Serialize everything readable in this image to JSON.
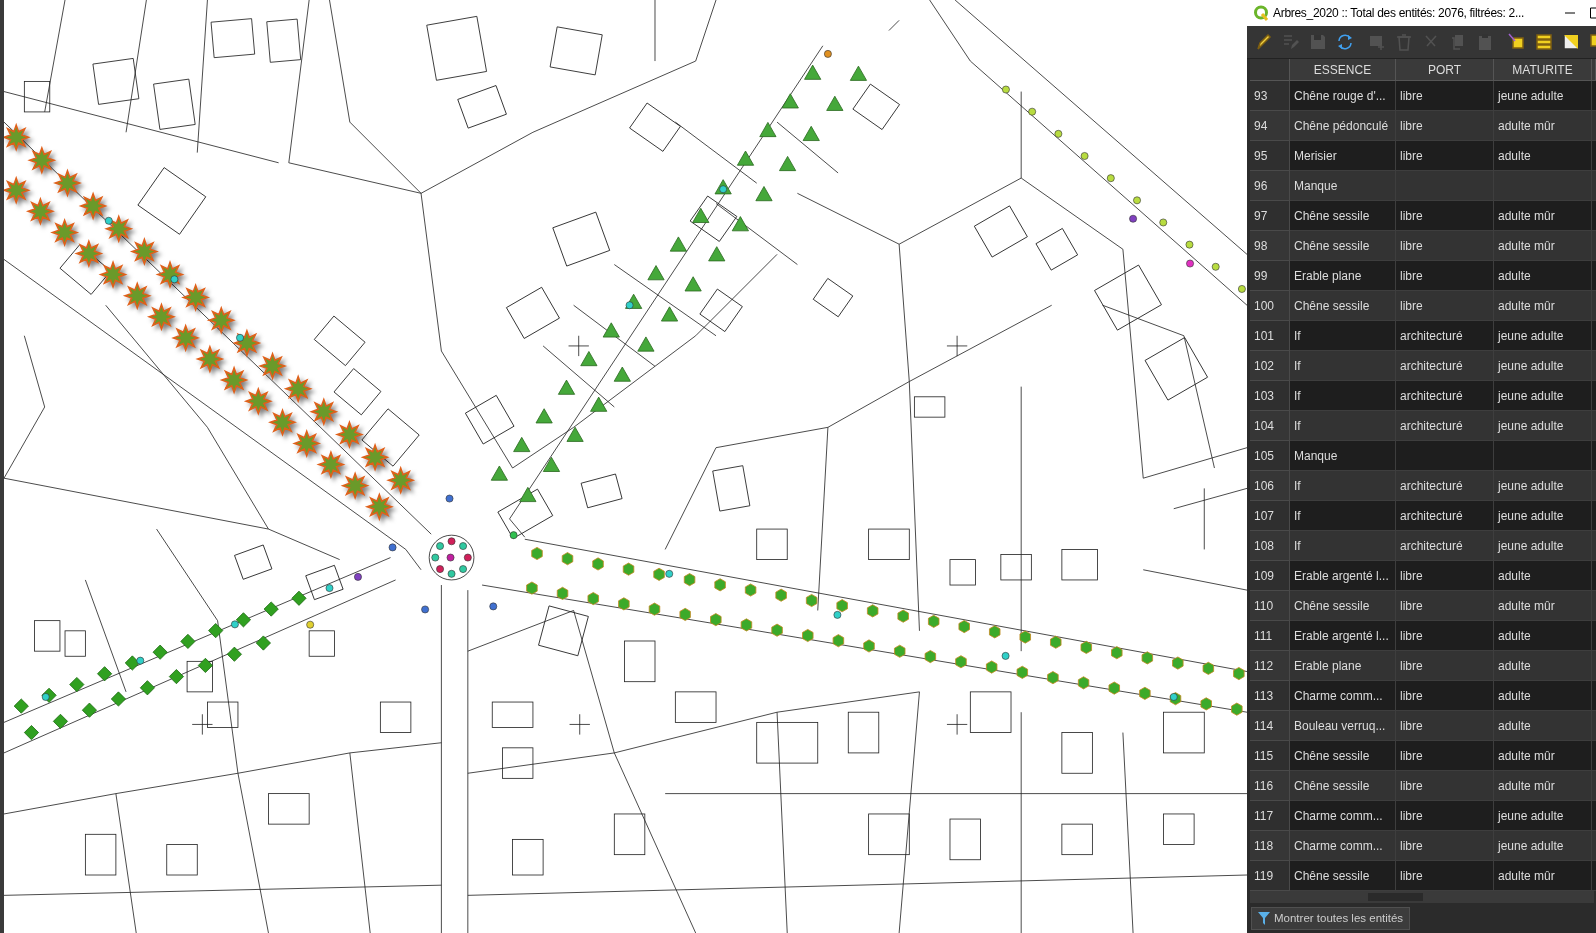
{
  "window": {
    "title": "Arbres_2020 :: Total des entités: 2076, filtrées: 2..."
  },
  "toolbar": [
    {
      "kind": "pencil",
      "disabled": false
    },
    {
      "kind": "multi-edit",
      "disabled": true
    },
    {
      "kind": "save",
      "disabled": true
    },
    {
      "kind": "reload",
      "disabled": false
    },
    {
      "kind": "add",
      "disabled": true
    },
    {
      "kind": "delete",
      "disabled": true
    },
    {
      "kind": "cut",
      "disabled": true
    },
    {
      "kind": "copy",
      "disabled": true
    },
    {
      "kind": "paste",
      "disabled": true
    },
    {
      "kind": "select-expression",
      "disabled": false
    },
    {
      "kind": "select-all",
      "disabled": false
    },
    {
      "kind": "invert",
      "disabled": false
    },
    {
      "kind": "deselect",
      "disabled": false
    }
  ],
  "table": {
    "columns": [
      "ESSENCE",
      "PORT",
      "MATURITE"
    ],
    "rows": [
      {
        "id": "93",
        "essence": "Chêne rouge d'...",
        "port": "libre",
        "maturite": "jeune adulte"
      },
      {
        "id": "94",
        "essence": "Chêne pédonculé",
        "port": "libre",
        "maturite": "adulte mûr"
      },
      {
        "id": "95",
        "essence": "Merisier",
        "port": "libre",
        "maturite": "adulte"
      },
      {
        "id": "96",
        "essence": "Manque"
      },
      {
        "id": "97",
        "essence": "Chêne sessile",
        "port": "libre",
        "maturite": "adulte mûr"
      },
      {
        "id": "98",
        "essence": "Chêne sessile",
        "port": "libre",
        "maturite": "adulte mûr"
      },
      {
        "id": "99",
        "essence": "Erable plane",
        "port": "libre",
        "maturite": "adulte"
      },
      {
        "id": "100",
        "essence": "Chêne sessile",
        "port": "libre",
        "maturite": "adulte mûr"
      },
      {
        "id": "101",
        "essence": "If",
        "port": "architecturé",
        "maturite": "jeune adulte"
      },
      {
        "id": "102",
        "essence": "If",
        "port": "architecturé",
        "maturite": "jeune adulte"
      },
      {
        "id": "103",
        "essence": "If",
        "port": "architecturé",
        "maturite": "jeune adulte"
      },
      {
        "id": "104",
        "essence": "If",
        "port": "architecturé",
        "maturite": "jeune adulte"
      },
      {
        "id": "105",
        "essence": "Manque"
      },
      {
        "id": "106",
        "essence": "If",
        "port": "architecturé",
        "maturite": "jeune adulte"
      },
      {
        "id": "107",
        "essence": "If",
        "port": "architecturé",
        "maturite": "jeune adulte"
      },
      {
        "id": "108",
        "essence": "If",
        "port": "architecturé",
        "maturite": "jeune adulte"
      },
      {
        "id": "109",
        "essence": "Erable argenté l...",
        "port": "libre",
        "maturite": "adulte"
      },
      {
        "id": "110",
        "essence": "Chêne sessile",
        "port": "libre",
        "maturite": "adulte mûr"
      },
      {
        "id": "111",
        "essence": "Erable argenté l...",
        "port": "libre",
        "maturite": "adulte"
      },
      {
        "id": "112",
        "essence": "Erable plane",
        "port": "libre",
        "maturite": "adulte"
      },
      {
        "id": "113",
        "essence": "Charme comm...",
        "port": "libre",
        "maturite": "adulte"
      },
      {
        "id": "114",
        "essence": "Bouleau verruq...",
        "port": "libre",
        "maturite": "adulte"
      },
      {
        "id": "115",
        "essence": "Chêne sessile",
        "port": "libre",
        "maturite": "adulte mûr"
      },
      {
        "id": "116",
        "essence": "Chêne sessile",
        "port": "libre",
        "maturite": "adulte mûr"
      },
      {
        "id": "117",
        "essence": "Charme comm...",
        "port": "libre",
        "maturite": "jeune adulte"
      },
      {
        "id": "118",
        "essence": "Charme comm...",
        "port": "libre",
        "maturite": "jeune adulte"
      },
      {
        "id": "119",
        "essence": "Chêne sessile",
        "port": "libre",
        "maturite": "adulte mûr"
      }
    ]
  },
  "filter_button": {
    "label": "Montrer toutes les entités"
  }
}
